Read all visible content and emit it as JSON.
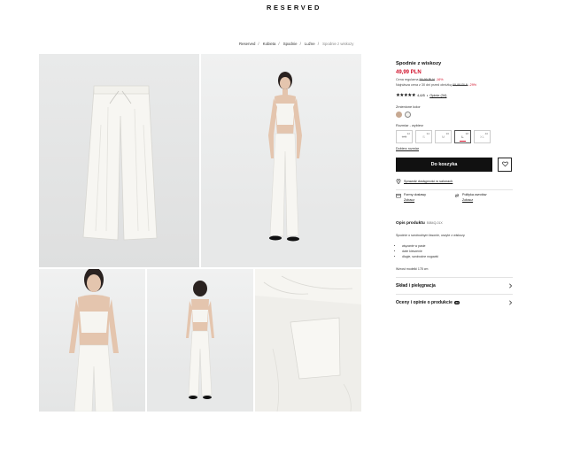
{
  "header": {
    "logo": "RESERVED"
  },
  "breadcrumb": [
    {
      "label": "Reserved"
    },
    {
      "label": "Kobieta"
    },
    {
      "label": "Spodnie"
    },
    {
      "label": "Luźne"
    },
    {
      "label": "Spodnie z wiskozy"
    }
  ],
  "product": {
    "title": "Spodnie z wiskozy",
    "price": "49,99 PLN",
    "regular_price_label": "Cena regularna",
    "regular_price": "59,99 PLN",
    "regular_discount": "-16%",
    "lowest_price_label": "Najniższa cena z 30 dni przed obniżką",
    "lowest_price": "69,99 PLN",
    "lowest_discount": "-29%",
    "rating_stars": "★★★★★",
    "rating_value": "4,6/5",
    "rating_link": "Opinie (34)",
    "color_label": "Zmienione kolor",
    "colors": [
      "#c7a992",
      "#f4f3ef"
    ],
    "size_label": "Rozmiar - wybierz",
    "sizes": [
      {
        "size": "XS",
        "num": "32",
        "state": "disabled"
      },
      {
        "size": "S",
        "num": "34",
        "state": "available"
      },
      {
        "size": "M",
        "num": "36",
        "state": "available"
      },
      {
        "size": "L",
        "num": "38",
        "state": "selected"
      },
      {
        "size": "XL",
        "num": "40",
        "state": "available"
      }
    ],
    "size_guide_link": "Dobierz rozmiar",
    "add_to_cart": "Do koszyka",
    "store_availability": "Sprawdź dostępność w salonach",
    "delivery": {
      "shipping_label": "Formy dostawy",
      "shipping_value": "Zobacz",
      "returns_label": "Polityka zwrotów",
      "returns_value": "Zobacz"
    },
    "description_title": "Opis produktu",
    "product_code": "5084Q-01X",
    "description": "Spodnie o swobodnym fasonie, uszyte z wiskozy.",
    "features": [
      "wiązanie w pasie",
      "dwie kieszenie",
      "długie, swobodne nogawki"
    ],
    "model_info": "Wzrost modelki 178 cm",
    "accordions": {
      "composition": "Skład i pielęgnacja",
      "reviews": "Oceny i opinie o produkcie",
      "reviews_badge": "34"
    }
  }
}
